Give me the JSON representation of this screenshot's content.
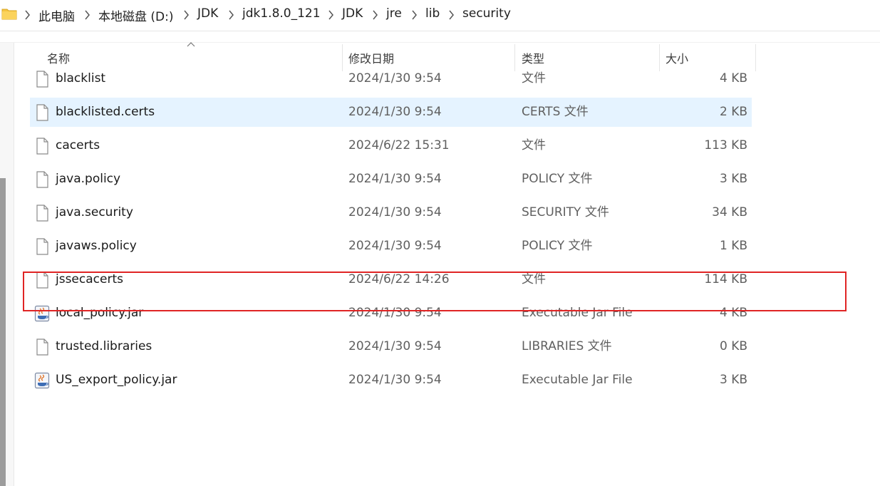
{
  "breadcrumb": {
    "items": [
      "此电脑",
      "本地磁盘 (D:)",
      "JDK",
      "jdk1.8.0_121",
      "JDK",
      "jre",
      "lib",
      "security"
    ]
  },
  "columns": {
    "name": "名称",
    "date": "修改日期",
    "type": "类型",
    "size": "大小"
  },
  "files": [
    {
      "name": "blacklist",
      "date": "2024/1/30 9:54",
      "type": "文件",
      "size": "4 KB",
      "icon": "file-icon"
    },
    {
      "name": "blacklisted.certs",
      "date": "2024/1/30 9:54",
      "type": "CERTS 文件",
      "size": "2 KB",
      "icon": "file-icon"
    },
    {
      "name": "cacerts",
      "date": "2024/6/22 15:31",
      "type": "文件",
      "size": "113 KB",
      "icon": "file-icon"
    },
    {
      "name": "java.policy",
      "date": "2024/1/30 9:54",
      "type": "POLICY 文件",
      "size": "3 KB",
      "icon": "file-icon"
    },
    {
      "name": "java.security",
      "date": "2024/1/30 9:54",
      "type": "SECURITY 文件",
      "size": "34 KB",
      "icon": "file-icon"
    },
    {
      "name": "javaws.policy",
      "date": "2024/1/30 9:54",
      "type": "POLICY 文件",
      "size": "1 KB",
      "icon": "file-icon"
    },
    {
      "name": "jssecacerts",
      "date": "2024/6/22 14:26",
      "type": "文件",
      "size": "114 KB",
      "icon": "file-icon"
    },
    {
      "name": "local_policy.jar",
      "date": "2024/1/30 9:54",
      "type": "Executable Jar File",
      "size": "4 KB",
      "icon": "jar-icon"
    },
    {
      "name": "trusted.libraries",
      "date": "2024/1/30 9:54",
      "type": "LIBRARIES 文件",
      "size": "0 KB",
      "icon": "file-icon"
    },
    {
      "name": "US_export_policy.jar",
      "date": "2024/1/30 9:54",
      "type": "Executable Jar File",
      "size": "3 KB",
      "icon": "jar-icon"
    }
  ],
  "selected_index": 1,
  "highlighted_index": 6,
  "colors": {
    "selection": "#e5f3ff",
    "highlight_border": "#e02424",
    "folder": "#f5c542"
  }
}
